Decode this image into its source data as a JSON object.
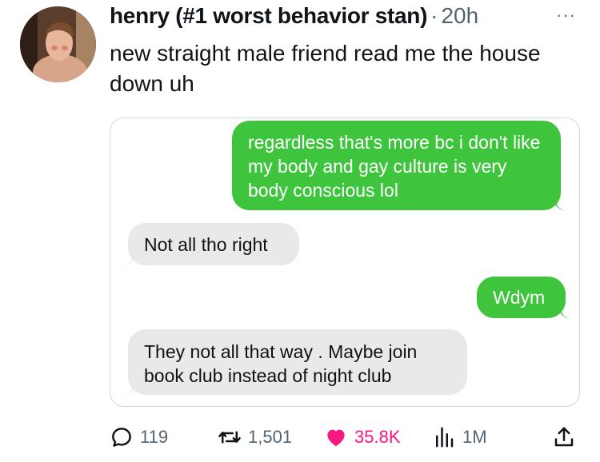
{
  "tweet": {
    "author_name": "henry (#1 worst behavior stan)",
    "separator": "·",
    "time": "20h",
    "more_label": "···",
    "text": "new straight male friend read me the house down uh"
  },
  "messages": [
    {
      "direction": "sent",
      "text": "regardless that's more bc i don't like my body and gay culture is very body conscious lol"
    },
    {
      "direction": "received",
      "text": "Not all tho right"
    },
    {
      "direction": "sent",
      "text": "Wdym"
    },
    {
      "direction": "received",
      "text": "They not all that way . Maybe join book club instead of night club"
    }
  ],
  "actions": {
    "replies": "119",
    "reposts": "1,501",
    "likes": "35.8K",
    "views": "1M"
  },
  "icons": {
    "reply": "reply-icon",
    "repost": "repost-icon",
    "like": "heart-icon",
    "views": "views-icon",
    "share": "share-icon"
  },
  "colors": {
    "sent_bubble": "#3ec43d",
    "received_bubble": "#e9e9eb",
    "like_active": "#f91880",
    "secondary_text": "#536471"
  }
}
